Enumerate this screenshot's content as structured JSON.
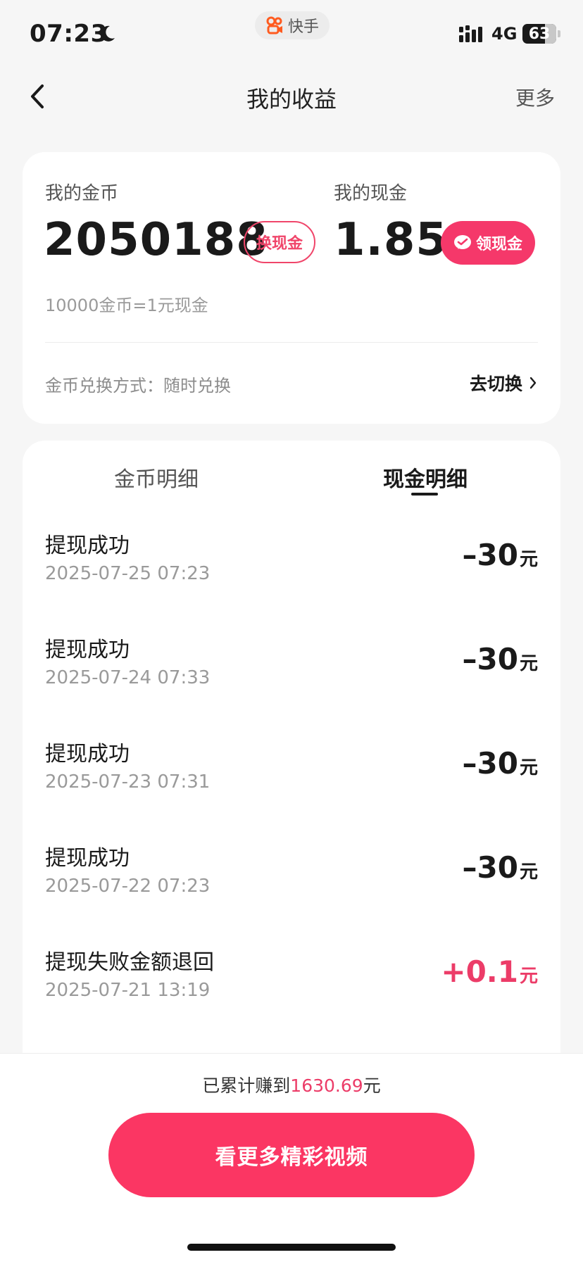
{
  "status_bar": {
    "time": "07:23",
    "app_name": "快手",
    "network": "4G",
    "battery": "63"
  },
  "header": {
    "title": "我的收益",
    "more": "更多"
  },
  "earnings": {
    "coins_label": "我的金币",
    "coins_value": "2050188",
    "exchange_button": "换现金",
    "cash_label": "我的现金",
    "cash_value": "1.85",
    "withdraw_button": "领现金",
    "rate": "10000金币=1元现金",
    "exchange_method": "金币兑换方式：随时兑换",
    "switch_label": "去切换"
  },
  "tabs": {
    "coins": "金币明细",
    "cash": "现金明细"
  },
  "transactions": [
    {
      "title": "提现成功",
      "date": "2025-07-25 07:23",
      "amount": "–30",
      "unit": "元"
    },
    {
      "title": "提现成功",
      "date": "2025-07-24 07:33",
      "amount": "–30",
      "unit": "元"
    },
    {
      "title": "提现成功",
      "date": "2025-07-23 07:31",
      "amount": "–30",
      "unit": "元"
    },
    {
      "title": "提现成功",
      "date": "2025-07-22 07:23",
      "amount": "–30",
      "unit": "元"
    },
    {
      "title": "提现失败金额退回",
      "date": "2025-07-21 13:19",
      "amount": "+0.1",
      "unit": "元"
    }
  ],
  "footer": {
    "total_prefix": "已累计赚到",
    "total_value": "1630.69",
    "total_suffix": "元",
    "cta": "看更多精彩视频"
  },
  "colors": {
    "accent": "#f5386a",
    "positive": "#ec3c68",
    "background": "#f6f6f6"
  }
}
